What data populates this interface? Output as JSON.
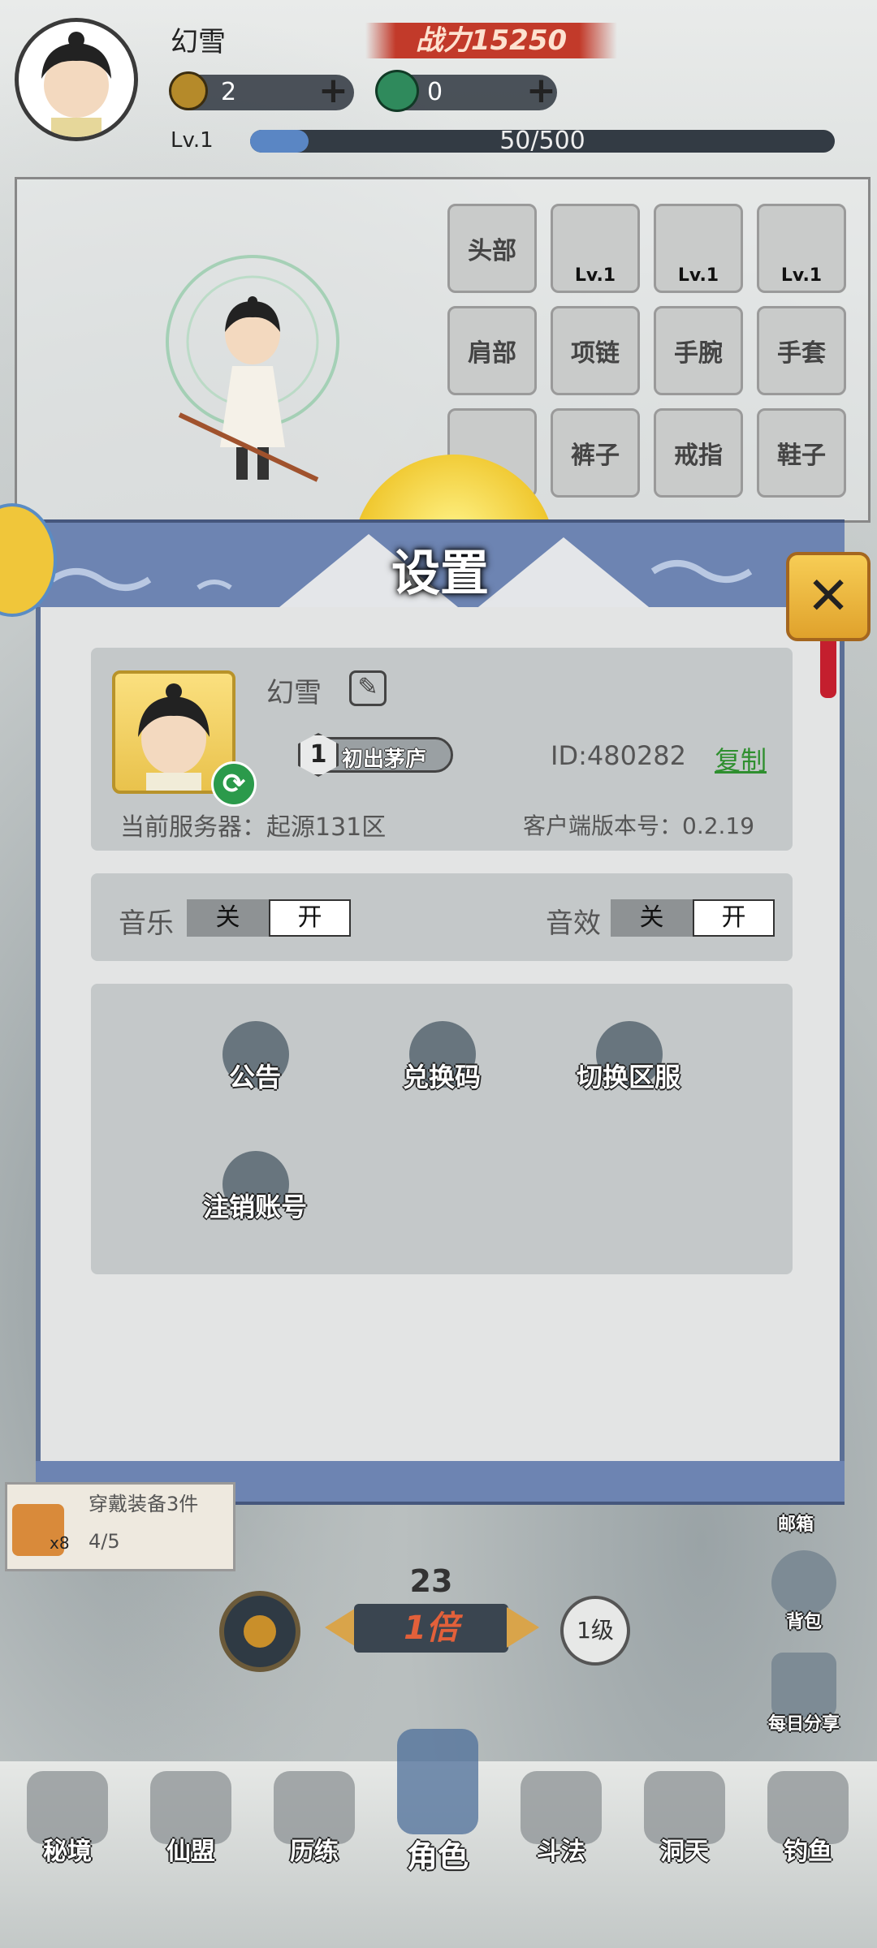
{
  "header": {
    "player_name": "幻雪",
    "power_text": "战力15250",
    "coins": "2",
    "jade": "0",
    "level": "Lv.1",
    "exp_text": "50/500",
    "exp_progress": 0.1
  },
  "equipment": {
    "slots": [
      {
        "label": "头部"
      },
      {
        "label": "",
        "level": "Lv.1"
      },
      {
        "label": "",
        "level": "Lv.1"
      },
      {
        "label": "",
        "level": "Lv.1"
      },
      {
        "label": "肩部"
      },
      {
        "label": "项链"
      },
      {
        "label": "手腕"
      },
      {
        "label": "手套"
      },
      {
        "label": ""
      },
      {
        "label": "裤子"
      },
      {
        "label": "戒指"
      },
      {
        "label": "鞋子"
      }
    ]
  },
  "dialog": {
    "title": "设置",
    "profile": {
      "name": "幻雪",
      "rank_number": "1",
      "rank_title": "初出茅庐",
      "id_text": "ID:480282",
      "copy_label": "复制",
      "server_text": "当前服务器：起源131区",
      "version_text": "客户端版本号：0.2.19"
    },
    "audio": {
      "music_label": "音乐",
      "sfx_label": "音效",
      "off_label": "关",
      "on_label": "开"
    },
    "functions": {
      "notice": "公告",
      "redeem": "兑换码",
      "switch_server": "切换区服",
      "delete_account": "注销账号"
    }
  },
  "side": {
    "mail": "邮箱",
    "bag": "背包",
    "share": "每日分享"
  },
  "battle": {
    "task_text": "穿戴装备3件",
    "task_count": "x8",
    "task_progress": "4/5",
    "stage_number": "23",
    "speed_label": "1倍",
    "grade_label": "1级"
  },
  "nav": {
    "items": [
      "秘境",
      "仙盟",
      "历练",
      "角色",
      "斗法",
      "洞天",
      "钓鱼"
    ]
  },
  "colors": {
    "dialog_frame": "#6d84b2",
    "copy_link": "#2f8f2f",
    "close_button": "#f0b840"
  }
}
